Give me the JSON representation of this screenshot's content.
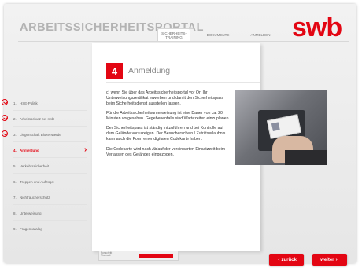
{
  "header": {
    "portal_title": "ARBEITSSICHERHEITSPORTAL",
    "tabs": [
      {
        "label": "SICHERHEITS-\nTRAINING",
        "active": true
      },
      {
        "label": "DOKUMENTE",
        "active": false
      },
      {
        "label": "ANMELDEN",
        "active": false
      }
    ],
    "logo": "swb"
  },
  "sidebar": {
    "items": [
      {
        "num": "1.",
        "label": "HSE-Politik",
        "done": true,
        "active": false
      },
      {
        "num": "2.",
        "label": "Arbeitsschutz bei swb",
        "done": true,
        "active": false
      },
      {
        "num": "3.",
        "label": "Liegenschaft Blokenwerde",
        "done": true,
        "active": false
      },
      {
        "num": "4.",
        "label": "Anmeldung",
        "done": false,
        "active": true
      },
      {
        "num": "5.",
        "label": "Verkehrssicherheit",
        "done": false,
        "active": false
      },
      {
        "num": "6.",
        "label": "Treppen und Aufzüge",
        "done": false,
        "active": false
      },
      {
        "num": "7.",
        "label": "Nichtraucherschutz",
        "done": false,
        "active": false
      },
      {
        "num": "8.",
        "label": "Unterweisung",
        "done": false,
        "active": false
      },
      {
        "num": "9.",
        "label": "Fragenkatalog",
        "done": false,
        "active": false
      }
    ]
  },
  "section": {
    "number": "4",
    "title": "Anmeldung",
    "paragraphs": [
      "c) wenn Sie über das Arbeitssicherheitsportal vor Ort Ihr Unterweisungszertifikat erwerben und damit den Sicherheitspass beim Sicherheitsdienst ausstellen lassen.",
      "Für die Arbeitssicherheitsunterweisung ist eine Dauer von ca. 20 Minuten vorgesehen. Gegebenenfalls sind Wartezeiten einzuplanen.",
      "Der Sicherheitspass ist ständig mitzuführen und bei Kontrolle auf dem Gelände vorzuzeigen. Der Besucherschein / Zutrittserlaubnis kann auch die Form einer digitalen Codekarte haben.",
      "Die Codekarte wird nach Ablauf der vereinbarten Einsatzzeit beim Verlassen des Geländes eingezogen."
    ]
  },
  "footer": {
    "progress_label": "Fortschritt\nThema 4",
    "back_label": "zurück",
    "next_label": "weiter"
  },
  "colors": {
    "brand_red": "#e30613"
  }
}
